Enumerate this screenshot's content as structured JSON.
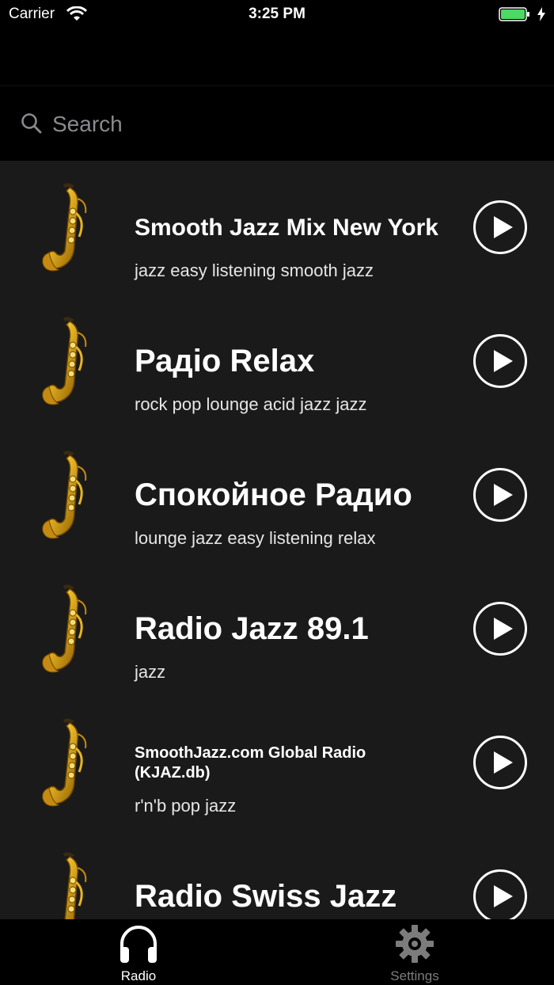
{
  "status_bar": {
    "carrier": "Carrier",
    "time": "3:25 PM",
    "battery_color": "#4cd964"
  },
  "search": {
    "placeholder": "Search",
    "value": "",
    "icon": "search-icon"
  },
  "stations": [
    {
      "name": "Smooth Jazz Mix New York",
      "tags": "jazz easy listening smooth jazz",
      "icon": "saxophone-icon"
    },
    {
      "name": "Радio Relax",
      "tags": "rock pop lounge acid jazz jazz",
      "icon": "saxophone-icon"
    },
    {
      "name": "Спокойное Радио",
      "tags": "lounge jazz easy listening relax",
      "icon": "saxophone-icon"
    },
    {
      "name": "Radio Jazz 89.1",
      "tags": "jazz",
      "icon": "saxophone-icon"
    },
    {
      "name": "SmoothJazz.com Global Radio (KJAZ.db)",
      "tags": "r'n'b pop jazz",
      "icon": "saxophone-icon"
    },
    {
      "name": "Radio Swiss Jazz",
      "tags": "",
      "icon": "saxophone-icon"
    }
  ],
  "tab_bar": {
    "tabs": [
      {
        "label": "Radio",
        "icon": "headphones-icon",
        "selected": true
      },
      {
        "label": "Settings",
        "icon": "gear-icon",
        "selected": false
      }
    ],
    "active_color": "#ffffff",
    "inactive_color": "#7c7c7c"
  }
}
